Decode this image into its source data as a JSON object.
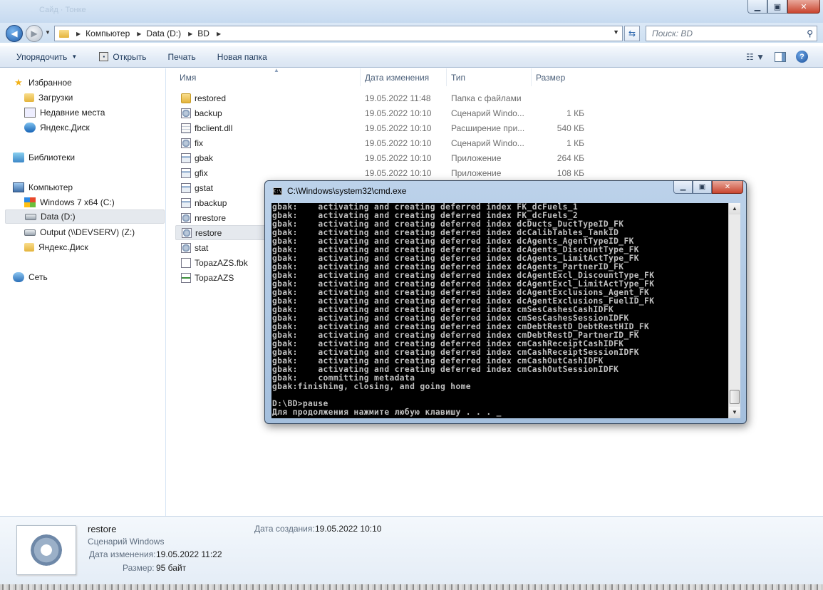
{
  "explorer": {
    "window_title_blur": "Сайд · Тонке",
    "address": [
      "Компьютер",
      "Data (D:)",
      "BD"
    ],
    "search_placeholder": "Поиск: BD"
  },
  "toolbar": {
    "organize": "Упорядочить",
    "open": "Открыть",
    "print": "Печать",
    "new_folder": "Новая папка"
  },
  "navpane": {
    "favorites": "Избранное",
    "favorites_items": [
      "Загрузки",
      "Недавние места",
      "Яндекс.Диск"
    ],
    "libraries": "Библиотеки",
    "computer": "Компьютер",
    "computer_items": [
      "Windows 7 x64 (C:)",
      "Data (D:)",
      "Output (\\\\DEVSERV) (Z:)",
      "Яндекс.Диск"
    ],
    "network": "Сеть"
  },
  "columns": {
    "name": "Имя",
    "date": "Дата изменения",
    "type": "Тип",
    "size": "Размер"
  },
  "files": [
    {
      "name": "restored",
      "date": "19.05.2022 11:48",
      "type": "Папка с файлами",
      "size": "",
      "icon": "folder-icon"
    },
    {
      "name": "backup",
      "date": "19.05.2022 10:10",
      "type": "Сценарий Windo...",
      "size": "1 КБ",
      "icon": "script-icon"
    },
    {
      "name": "fbclient.dll",
      "date": "19.05.2022 10:10",
      "type": "Расширение при...",
      "size": "540 КБ",
      "icon": "dll-icon"
    },
    {
      "name": "fix",
      "date": "19.05.2022 10:10",
      "type": "Сценарий Windo...",
      "size": "1 КБ",
      "icon": "script-icon"
    },
    {
      "name": "gbak",
      "date": "19.05.2022 10:10",
      "type": "Приложение",
      "size": "264 КБ",
      "icon": "exe-icon"
    },
    {
      "name": "gfix",
      "date": "19.05.2022 10:10",
      "type": "Приложение",
      "size": "108 КБ",
      "icon": "exe-icon"
    },
    {
      "name": "gstat",
      "icon": "exe-icon"
    },
    {
      "name": "nbackup",
      "icon": "exe-icon"
    },
    {
      "name": "nrestore",
      "icon": "script-icon"
    },
    {
      "name": "restore",
      "icon": "script-icon"
    },
    {
      "name": "stat",
      "icon": "script-icon"
    },
    {
      "name": "TopazAZS.fbk",
      "icon": "document-icon"
    },
    {
      "name": "TopazAZS",
      "icon": "database-icon"
    }
  ],
  "details": {
    "name": "restore",
    "type": "Сценарий Windows",
    "modified_label": "Дата изменения:",
    "modified_value": "19.05.2022 11:22",
    "size_label": "Размер:",
    "size_value": "95 байт",
    "created_label": "Дата создания:",
    "created_value": "19.05.2022 10:10"
  },
  "cmd": {
    "title": "C:\\Windows\\system32\\cmd.exe",
    "icon_text": "C:\\",
    "lines": [
      "gbak:    activating and creating deferred index FK_dcFuels_1",
      "gbak:    activating and creating deferred index FK_dcFuels_2",
      "gbak:    activating and creating deferred index dcDucts_DuctTypeID_FK",
      "gbak:    activating and creating deferred index dcCalibTables_TankID",
      "gbak:    activating and creating deferred index dcAgents_AgentTypeID_FK",
      "gbak:    activating and creating deferred index dcAgents_DiscountType_FK",
      "gbak:    activating and creating deferred index dcAgents_LimitActType_FK",
      "gbak:    activating and creating deferred index dcAgents_PartnerID_FK",
      "gbak:    activating and creating deferred index dcAgentExcl_DiscountType_FK",
      "gbak:    activating and creating deferred index dcAgentExcl_LimitActType_FK",
      "gbak:    activating and creating deferred index dcAgentExclusions_Agent_FK",
      "gbak:    activating and creating deferred index dcAgentExclusions_FuelID_FK",
      "gbak:    activating and creating deferred index cmSesCashesCashIDFK",
      "gbak:    activating and creating deferred index cmSesCashesSessionIDFK",
      "gbak:    activating and creating deferred index cmDebtRestD_DebtRestHID_FK",
      "gbak:    activating and creating deferred index cmDebtRestD_PartnerID_FK",
      "gbak:    activating and creating deferred index cmCashReceiptCashIDFK",
      "gbak:    activating and creating deferred index cmCashReceiptSessionIDFK",
      "gbak:    activating and creating deferred index cmCashOutCashIDFK",
      "gbak:    activating and creating deferred index cmCashOutSessionIDFK",
      "gbak:    committing metadata",
      "gbak:finishing, closing, and going home",
      "",
      "D:\\BD>pause",
      "Для продолжения нажмите любую клавишу . . . _"
    ]
  }
}
